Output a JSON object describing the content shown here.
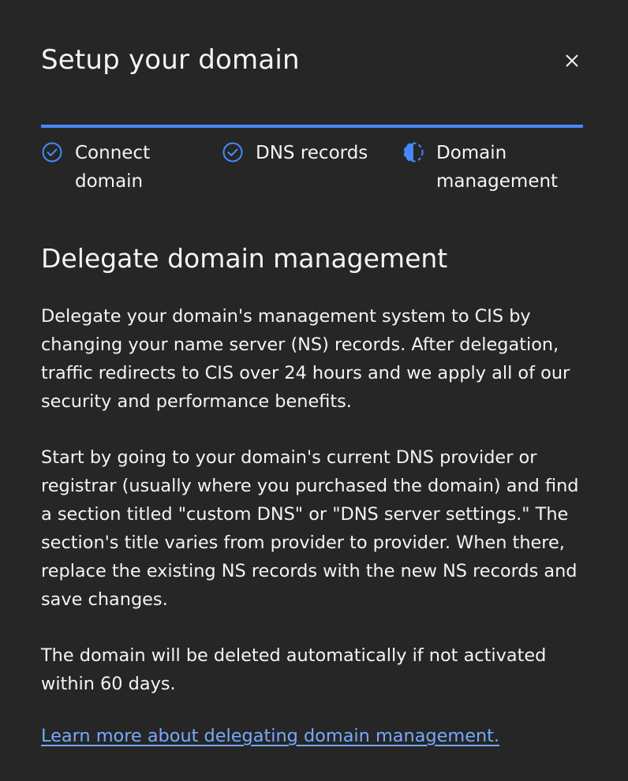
{
  "modal": {
    "title": "Setup your domain",
    "close_icon": "close-icon",
    "accent_color": "#4589ff",
    "link_color": "#78a9ff",
    "background_color": "#262626"
  },
  "progress": {
    "steps": [
      {
        "label": "Connect domain",
        "status": "complete",
        "icon": "checkmark-outline-icon"
      },
      {
        "label": "DNS records",
        "status": "complete",
        "icon": "checkmark-outline-icon"
      },
      {
        "label": "Domain management",
        "status": "current",
        "icon": "incomplete-half-circle-icon"
      }
    ]
  },
  "content": {
    "heading": "Delegate domain management",
    "paragraphs": [
      "Delegate your domain's management system to CIS by changing your name server (NS) records. After delegation, traffic redirects to CIS over 24 hours and we apply all of our security and performance benefits.",
      "Start by going to your domain's current DNS provider or registrar (usually where you purchased the domain) and find a section titled \"custom DNS\" or \"DNS server settings.\" The section's title varies from provider to provider. When there, replace the existing NS records with the new NS records and save changes.",
      "The domain will be deleted automatically if not activated within 60 days."
    ],
    "link_text": "Learn more about delegating domain management."
  }
}
